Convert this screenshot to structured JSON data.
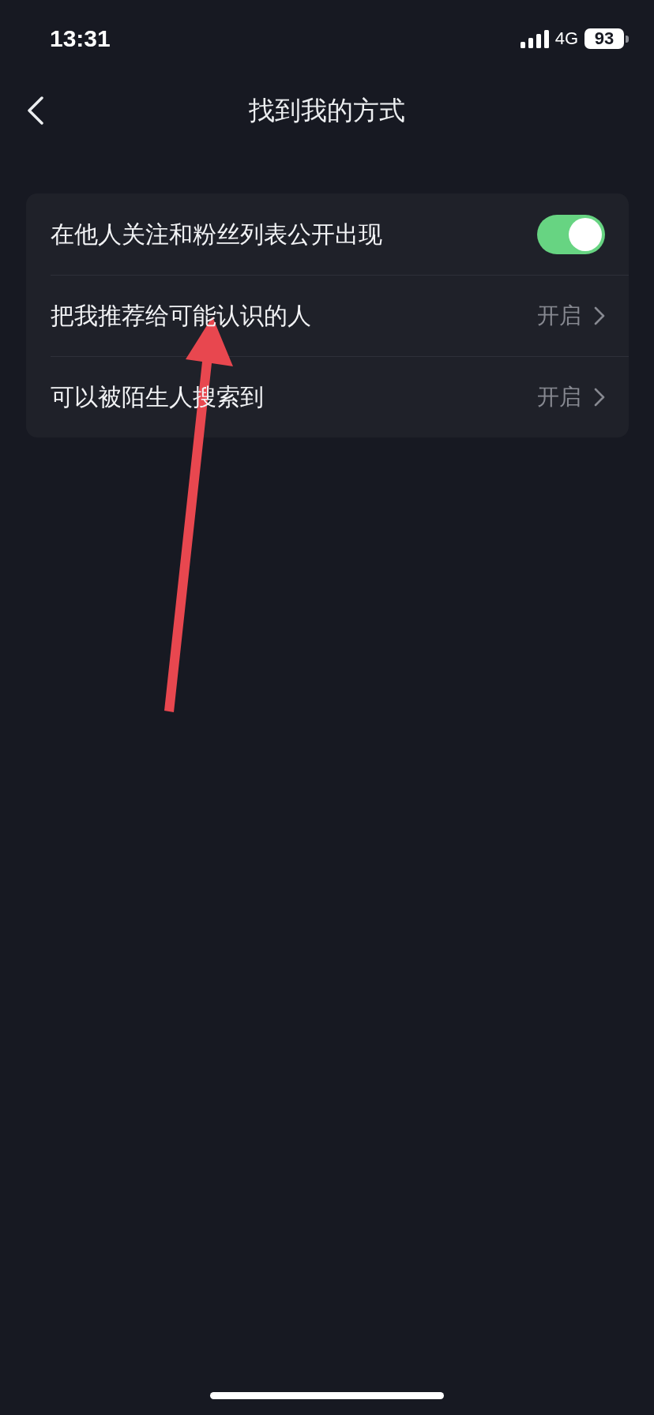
{
  "status_bar": {
    "time": "13:31",
    "network": "4G",
    "battery": "93"
  },
  "header": {
    "title": "找到我的方式"
  },
  "settings": [
    {
      "kind": "toggle",
      "label": "在他人关注和粉丝列表公开出现",
      "on": true
    },
    {
      "kind": "link",
      "label": "把我推荐给可能认识的人",
      "value": "开启"
    },
    {
      "kind": "link",
      "label": "可以被陌生人搜索到",
      "value": "开启"
    }
  ],
  "overlay": {
    "kind": "arrow"
  }
}
